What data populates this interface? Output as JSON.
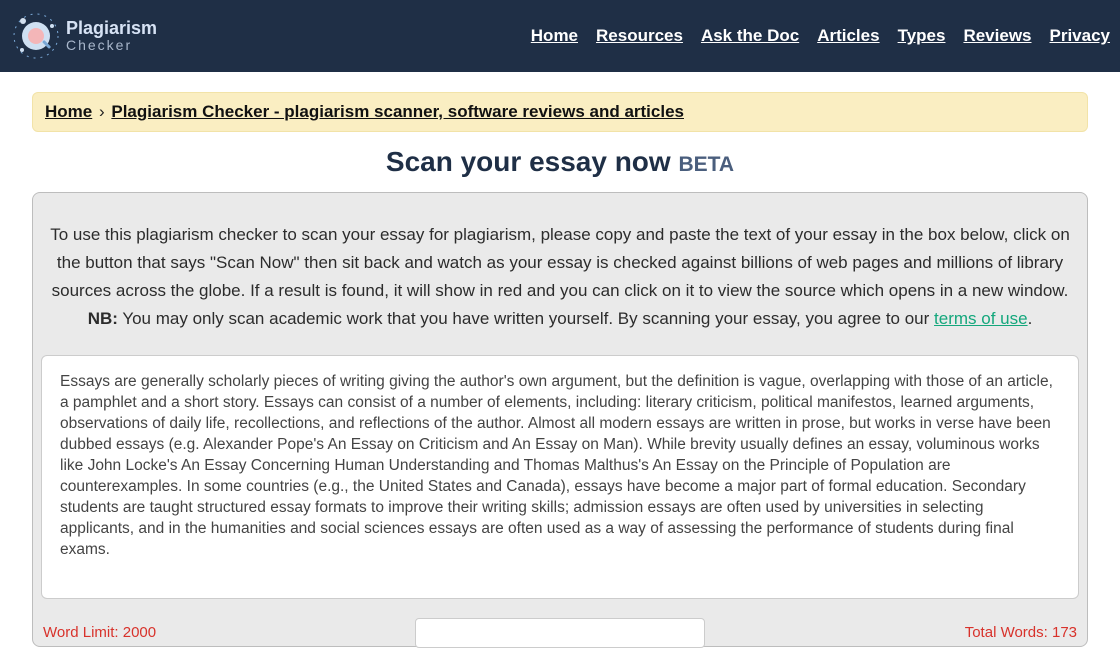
{
  "header": {
    "logo_top": "Plagiarism",
    "logo_bottom": "Checker",
    "nav": [
      "Home",
      "Resources",
      "Ask the Doc",
      "Articles",
      "Types",
      "Reviews",
      "Privacy"
    ]
  },
  "breadcrumb": {
    "home": "Home",
    "sep": "›",
    "current": "Plagiarism Checker - plagiarism scanner, software reviews and articles"
  },
  "title_main": "Scan your essay now ",
  "title_beta": "BETA",
  "instructions": {
    "body": "To use this plagiarism checker to scan your essay for plagiarism, please copy and paste the text of your essay in the box below, click on the button that says \"Scan Now\" then sit back and watch as your essay is checked against billions of web pages and millions of library sources across the globe. If a result is found, it will show in red and you can click on it to view the source which opens in a new window.",
    "nb_label": "NB:",
    "nb_text": " You may only scan academic work that you have written yourself. By scanning your essay, you agree to our ",
    "terms_link": "terms of use",
    "tail": "."
  },
  "essay_text": "Essays are generally scholarly pieces of writing giving the author's own argument, but the definition is vague, overlapping with those of an article, a pamphlet and a short story. Essays can consist of a number of elements, including: literary criticism, political manifestos, learned arguments, observations of daily life, recollections, and reflections of the author. Almost all modern essays are written in prose, but works in verse have been dubbed essays (e.g. Alexander Pope's An Essay on Criticism and An Essay on Man). While brevity usually defines an essay, voluminous works like John Locke's An Essay Concerning Human Understanding and Thomas Malthus's An Essay on the Principle of Population are counterexamples. In some countries (e.g., the United States and Canada), essays have become a major part of formal education. Secondary students are taught structured essay formats to improve their writing skills; admission essays are often used by universities in selecting applicants, and in the humanities and social sciences essays are often used as a way of assessing the performance of students during final exams.",
  "footer": {
    "word_limit": "Word Limit: 2000",
    "total_words": "Total Words: 173"
  }
}
